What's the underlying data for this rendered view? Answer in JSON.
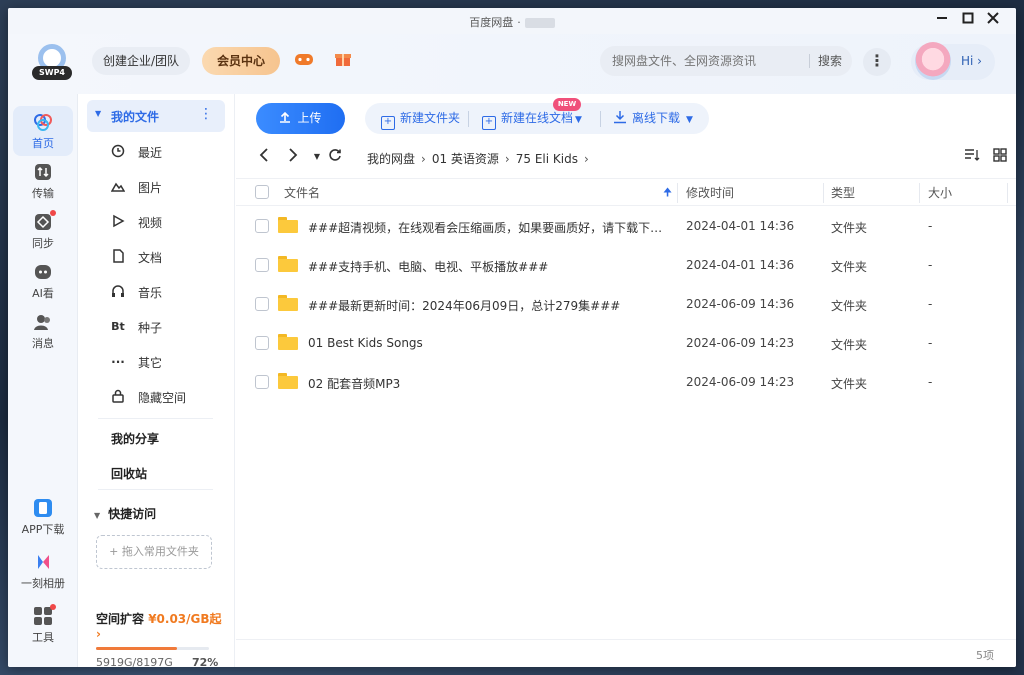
{
  "window": {
    "title": "百度网盘",
    "title_dot": "·"
  },
  "header": {
    "logo_badge": "SWP4",
    "team_button": "创建企业/团队",
    "vip_button": "会员中心",
    "search_placeholder": "搜网盘文件、全网资源资讯",
    "search_button": "搜索",
    "more_label": "⋮",
    "user_greeting": "Hi ›"
  },
  "leftnav": {
    "items": [
      {
        "label": "首页",
        "icon": "home-icon"
      },
      {
        "label": "传输",
        "icon": "transfer-icon"
      },
      {
        "label": "同步",
        "icon": "sync-icon"
      },
      {
        "label": "AI看",
        "icon": "ai-icon"
      },
      {
        "label": "消息",
        "icon": "message-icon"
      },
      {
        "label": "APP下载",
        "icon": "app-download-icon"
      },
      {
        "label": "一刻相册",
        "icon": "album-icon"
      },
      {
        "label": "工具",
        "icon": "tools-icon"
      }
    ]
  },
  "sidebar": {
    "my_files": "我的文件",
    "items": [
      {
        "label": "最近",
        "icon": "clock-icon"
      },
      {
        "label": "图片",
        "icon": "image-icon"
      },
      {
        "label": "视频",
        "icon": "video-icon"
      },
      {
        "label": "文档",
        "icon": "document-icon"
      },
      {
        "label": "音乐",
        "icon": "music-icon"
      },
      {
        "label": "种子",
        "icon": "torrent-icon"
      },
      {
        "label": "其它",
        "icon": "other-icon"
      },
      {
        "label": "隐藏空间",
        "icon": "lock-icon"
      }
    ],
    "my_share": "我的分享",
    "recycle": "回收站",
    "quick_access": "快捷访问",
    "drop_hint": "+ 拖入常用文件夹",
    "quota_title": "空间扩容",
    "quota_price": "¥0.03/GB起",
    "quota_used": "5919G/8197G",
    "quota_percent": "72%",
    "quota_fraction": 0.72
  },
  "toolbar": {
    "upload": "上传",
    "new_folder": "新建文件夹",
    "new_online_doc": "新建在线文档",
    "new_badge": "NEW",
    "offline_download": "离线下载"
  },
  "breadcrumb": {
    "items": [
      "我的网盘",
      "01 英语资源",
      "75 Eli Kids"
    ]
  },
  "table": {
    "columns": {
      "name": "文件名",
      "modified": "修改时间",
      "type": "类型",
      "size": "大小"
    },
    "rows": [
      {
        "name": "###超清视频，在线观看会压缩画质，如果要画质好，请下载下来观...",
        "modified": "2024-04-01 14:36",
        "type": "文件夹",
        "size": "-"
      },
      {
        "name": "###支持手机、电脑、电视、平板播放###",
        "modified": "2024-04-01 14:36",
        "type": "文件夹",
        "size": "-"
      },
      {
        "name": "###最新更新时间：2024年06月09日，总计279集###",
        "modified": "2024-06-09 14:36",
        "type": "文件夹",
        "size": "-"
      },
      {
        "name": "01 Best Kids Songs",
        "modified": "2024-06-09 14:23",
        "type": "文件夹",
        "size": "-"
      },
      {
        "name": "02 配套音频MP3",
        "modified": "2024-06-09 14:23",
        "type": "文件夹",
        "size": "-"
      }
    ]
  },
  "footer": {
    "count": "5项"
  },
  "colors": {
    "accent": "#2e6be6",
    "folder": "#fcc93c",
    "vip": "#f6c48f",
    "quota_fill": "#f07a3a"
  }
}
